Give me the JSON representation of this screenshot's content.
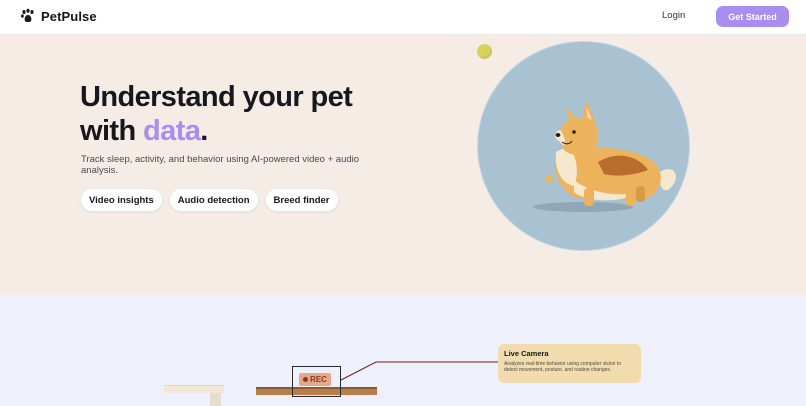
{
  "header": {
    "brand": "PetPulse",
    "login_label": "Login",
    "cta_label": "Get Started"
  },
  "hero": {
    "headline_part1": "Understand your pet",
    "headline_part2": "with ",
    "headline_accent": "data",
    "headline_end": ".",
    "subtext": "Track sleep, activity, and behavior using AI-powered video + audio analysis.",
    "chips": [
      "Video insights",
      "Audio detection",
      "Breed finder"
    ]
  },
  "illustration": {
    "rec_label": "REC"
  },
  "callout": {
    "title": "Live Camera",
    "description": "Analyzes real-time behavior using computer vision to detect movement, posture, and routine changes."
  },
  "colors": {
    "accent": "#a98df0",
    "hero_bg": "#f5ede5",
    "lower_bg": "#eef1fc",
    "callout_bg": "#f2dcad"
  },
  "icons": {
    "logo": "paw-icon"
  }
}
